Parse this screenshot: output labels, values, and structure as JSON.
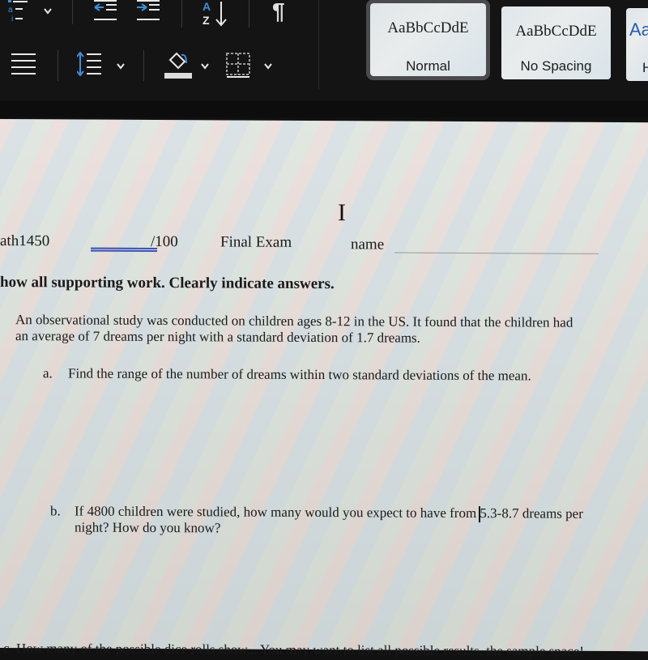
{
  "ribbon": {
    "styles": [
      {
        "sample": "AaBbCcDdE",
        "name": "Normal",
        "selected": true
      },
      {
        "sample": "AaBbCcDdE",
        "name": "No Spacing",
        "selected": false
      },
      {
        "sample": "Aa",
        "name": "H",
        "selected": false
      }
    ],
    "icons": [
      "multilevel-list-icon",
      "decrease-indent-icon",
      "increase-indent-icon",
      "sort-az-icon",
      "show-formatting-pilcrow-icon",
      "justify-icon",
      "line-spacing-icon",
      "shading-bucket-icon",
      "borders-icon"
    ],
    "sort_label_top": "A",
    "sort_label_bottom": "Z",
    "pilcrow": "¶"
  },
  "document": {
    "header": {
      "course": "ath1450",
      "score": "/100",
      "exam_title": "Final Exam",
      "name_label": "name"
    },
    "instructions": "how all supporting work. Clearly indicate answers.",
    "question": {
      "stem_line1": "An observational study was conducted on children ages 8-12 in the US. It found that the children had",
      "stem_line2": "an average of 7 dreams per night with a standard deviation of 1.7 dreams.",
      "part_a_label": "a.",
      "part_a_text": "Find the range of the number of dreams within two standard deviations of the mean.",
      "part_b_label": "b.",
      "part_b_line1": "If 4800 children were studied, how many would you expect to have from 5.3-8.7 dreams per",
      "part_b_line2": "night? How do you know?"
    },
    "next_question_partial": "c.   How many of the possible dice rolls show... You may want to list all possible results, the sample space!",
    "cursor": "I"
  }
}
